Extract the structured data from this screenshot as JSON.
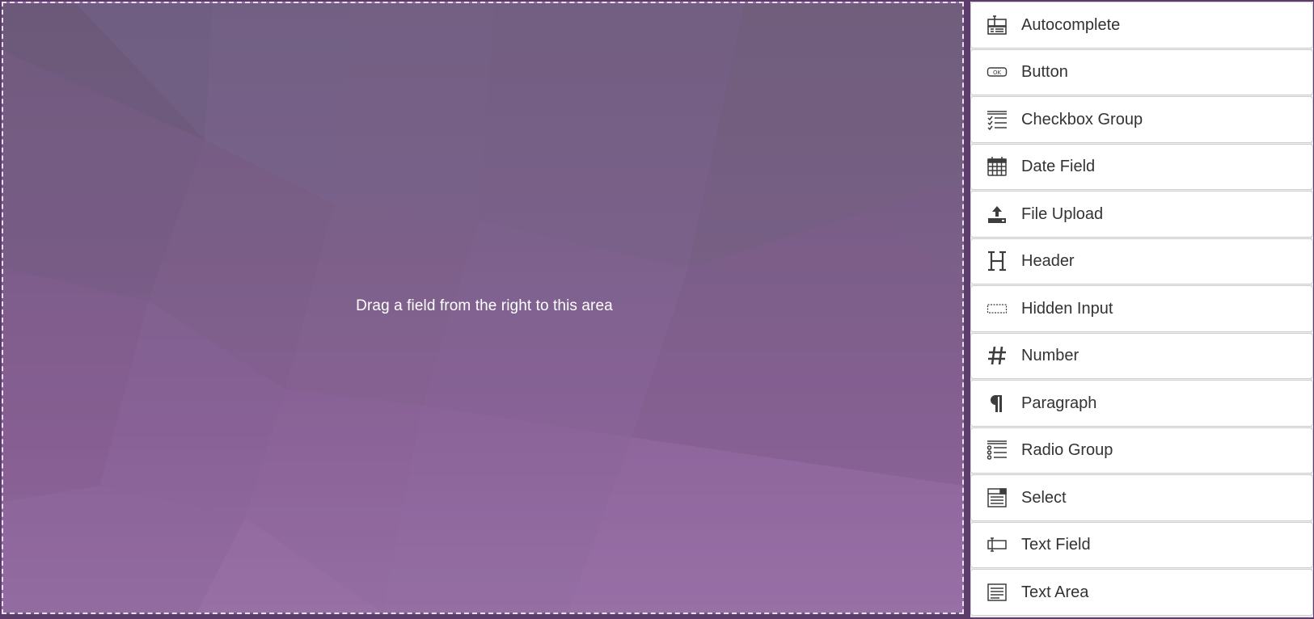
{
  "stage": {
    "hint": "Drag a field from the right to this area"
  },
  "fields": [
    {
      "label": "Autocomplete",
      "icon": "autocomplete-icon"
    },
    {
      "label": "Button",
      "icon": "button-icon"
    },
    {
      "label": "Checkbox Group",
      "icon": "checkbox-group-icon"
    },
    {
      "label": "Date Field",
      "icon": "calendar-icon"
    },
    {
      "label": "File Upload",
      "icon": "upload-icon"
    },
    {
      "label": "Header",
      "icon": "header-icon"
    },
    {
      "label": "Hidden Input",
      "icon": "hidden-input-icon"
    },
    {
      "label": "Number",
      "icon": "hash-icon"
    },
    {
      "label": "Paragraph",
      "icon": "paragraph-icon"
    },
    {
      "label": "Radio Group",
      "icon": "radio-group-icon"
    },
    {
      "label": "Select",
      "icon": "select-icon"
    },
    {
      "label": "Text Field",
      "icon": "text-field-icon"
    },
    {
      "label": "Text Area",
      "icon": "text-area-icon"
    }
  ],
  "colors": {
    "background": "#5b3c6a",
    "stage_top": "#6f5c7c",
    "stage_bottom": "#9670a4",
    "stage_border": "#e9e1ee",
    "item_background": "#ffffff",
    "item_text": "#333333"
  }
}
